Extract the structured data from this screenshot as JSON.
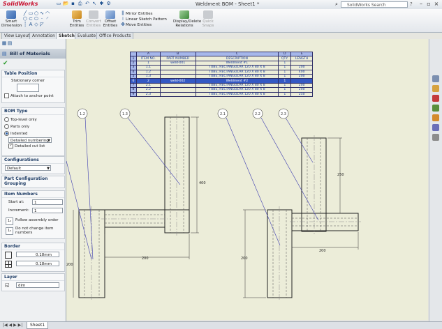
{
  "app": {
    "logo": "SolidWorks",
    "doc_title": "Weldment BOM - Sheet1 *",
    "search_placeholder": "SolidWorks Search"
  },
  "ribbon": {
    "smart_dimension": "Smart Dimension",
    "trim_entities": "Trim Entities",
    "convert_entities": "Convert Entities",
    "offset_entities": "Offset Entities",
    "mirror_entities": "Mirror Entities",
    "linear_sketch_pattern": "Linear Sketch Pattern",
    "move_entities": "Move Entities",
    "display_delete_relations": "Display/Delete Relations",
    "quick_snaps": "Quick Snaps"
  },
  "tabs": [
    "View Layout",
    "Annotation",
    "Sketch",
    "Evaluate",
    "Office Products"
  ],
  "active_tab": "Sketch",
  "property_manager": {
    "title": "Bill of Materials",
    "table_position": {
      "header": "Table Position",
      "stationary_corner": "Stationary corner",
      "attach_anchor": "Attach to anchor point"
    },
    "bom_type": {
      "header": "BOM Type",
      "top_level": "Top-level only",
      "parts_only": "Parts only",
      "indented": "Indented",
      "numbering": "Detailed numbering",
      "detailed_cut_list": "Detailed cut list"
    },
    "configurations": {
      "header": "Configurations",
      "value": "Default"
    },
    "part_config_grouping": {
      "header": "Part Configuration Grouping"
    },
    "item_numbers": {
      "header": "Item Numbers",
      "start_at_label": "Start at:",
      "start_at": "1",
      "increment_label": "Increment:",
      "increment": "1",
      "follow_assembly": "Follow assembly order",
      "do_not_change": "Do not change item numbers"
    },
    "border": {
      "header": "Border",
      "width1": "0.18mm",
      "width2": "0.18mm"
    },
    "layer": {
      "header": "Layer",
      "value": "dim"
    }
  },
  "bom": {
    "col_letters": [
      "A",
      "B",
      "C",
      "D",
      "E"
    ],
    "headers": [
      "ITEM NO.",
      "PART NUMBER",
      "DESCRIPTION",
      "QTY.",
      "LENGTH"
    ],
    "row_numbers": [
      "1",
      "2",
      "3",
      "4",
      "5",
      "6",
      "7",
      "8",
      "9",
      "10"
    ],
    "rows": [
      [
        "1",
        "weld-001",
        "Weldment #1",
        "1",
        ""
      ],
      [
        "1.1",
        "",
        "TUBE, RECTANGULAR 120 X 80 X 8",
        "1",
        "200"
      ],
      [
        "1.2",
        "",
        "TUBE, RECTANGULAR 120 X 80 X 8",
        "1",
        "400"
      ],
      [
        "1.3",
        "",
        "TUBE, RECTANGULAR 120 X 80 X 8",
        "1",
        "200"
      ],
      [
        "2",
        "weld-002",
        "Weldment #2",
        "1",
        ""
      ],
      [
        "2.1",
        "",
        "TUBE, RECTANGULAR 120 X 80 X 8",
        "1",
        "200"
      ],
      [
        "2.2",
        "",
        "TUBE, RECTANGULAR 120 X 80 X 8",
        "1",
        "200"
      ],
      [
        "2.3",
        "",
        "TUBE, RECTANGULAR 120 X 80 X 8",
        "1",
        "250"
      ]
    ],
    "selected_row": 4
  },
  "drawing": {
    "callouts_left": [
      "1.2",
      "1.3"
    ],
    "callouts_right": [
      "2.1",
      "2.2",
      "2.3"
    ],
    "dims_left": [
      "400",
      "200",
      "200"
    ],
    "dims_right": [
      "250",
      "200",
      "200"
    ]
  },
  "status": {
    "sheet_tab": "Sheet1"
  },
  "colors": {
    "bom_header": "#a6b7ea",
    "bom_text": "#1b3f9e",
    "selection": "#3459c4",
    "canvas": "#ecedd9",
    "leader": "#3b3bb0"
  }
}
